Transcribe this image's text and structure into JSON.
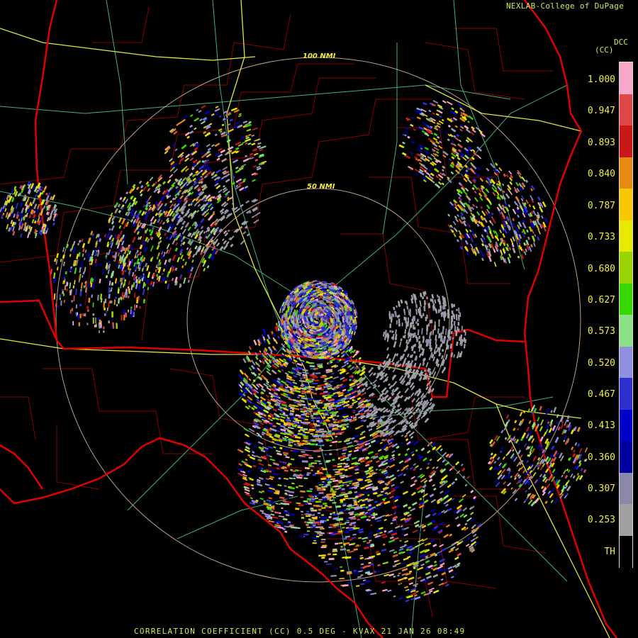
{
  "credit": "NEXLAB-College of DuPage",
  "product": {
    "code": "DCC",
    "units": "(CC)"
  },
  "range_rings": [
    "100 NMI",
    "50 NMI"
  ],
  "scale": {
    "labels": [
      "1.000",
      "0.947",
      "0.893",
      "0.840",
      "0.787",
      "0.733",
      "0.680",
      "0.627",
      "0.573",
      "0.520",
      "0.467",
      "0.413",
      "0.360",
      "0.307",
      "0.253",
      "TH"
    ],
    "colors": [
      "#f7a8c8",
      "#e04848",
      "#c81818",
      "#e88a10",
      "#f5c800",
      "#e8e800",
      "#9ad400",
      "#36d800",
      "#8be088",
      "#9090e0",
      "#3030d0",
      "#0000c8",
      "#0000a0",
      "#8a8aa8",
      "#a0a0a0",
      "#000000"
    ]
  },
  "status": "CORRELATION COEFFICIENT (CC) 0.5 DEG - KVAX 21 JAN 26 08:49"
}
